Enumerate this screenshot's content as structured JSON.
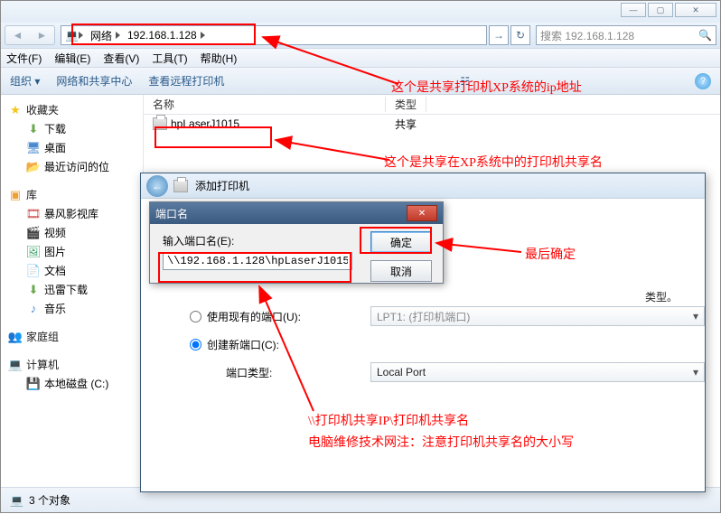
{
  "window": {
    "minimize": "—",
    "maximize": "▢",
    "close": "✕"
  },
  "address": {
    "root": "网络",
    "ip": "192.168.1.128",
    "refresh_icon": "↻",
    "go_icon": "→"
  },
  "search": {
    "placeholder": "搜索 192.168.1.128",
    "icon": "🔍"
  },
  "menu": {
    "file": "文件(F)",
    "edit": "编辑(E)",
    "view": "查看(V)",
    "tools": "工具(T)",
    "help": "帮助(H)"
  },
  "toolbar": {
    "organize": "组织 ▾",
    "netcenter": "网络和共享中心",
    "remote": "查看远程打印机",
    "view_icon": "☷",
    "help_icon": "?"
  },
  "sidebar": {
    "favorites": "收藏夹",
    "downloads": "下载",
    "desktop": "桌面",
    "recent": "最近访问的位",
    "library": "库",
    "stormlib": "暴风影视库",
    "video": "视频",
    "pictures": "图片",
    "documents": "文档",
    "xunlei": "迅雷下载",
    "music": "音乐",
    "homegroup": "家庭组",
    "computer": "计算机",
    "localdisk": "本地磁盘 (C:)"
  },
  "list": {
    "col_name": "名称",
    "col_type": "类型",
    "printer_name": "hpLaserJ1015",
    "printer_type": "共享"
  },
  "wizard": {
    "title": "添加打印机",
    "existing_label": "使用现有的端口(U):",
    "create_label": "创建新端口(C):",
    "port_type_label": "端口类型:",
    "port_dropdown_disabled": "LPT1: (打印机端口)",
    "port_dropdown_active": "Local Port",
    "hint_suffix": "类型。"
  },
  "subdlg": {
    "title": "端口名",
    "label": "输入端口名(E):",
    "value": "\\\\192.168.1.128\\hpLaserJ1015",
    "ok": "确定",
    "cancel": "取消"
  },
  "status": {
    "count": "3 个对象"
  },
  "annotations": {
    "a1": "这个是共享打印机XP系统的ip地址",
    "a2": "这个是共享在XP系统中的打印机共享名",
    "a3": "最后确定",
    "a4": "\\\\打印机共享IP\\打印机共享名",
    "a5": "电脑维修技术网注：注意打印机共享名的大小写"
  }
}
